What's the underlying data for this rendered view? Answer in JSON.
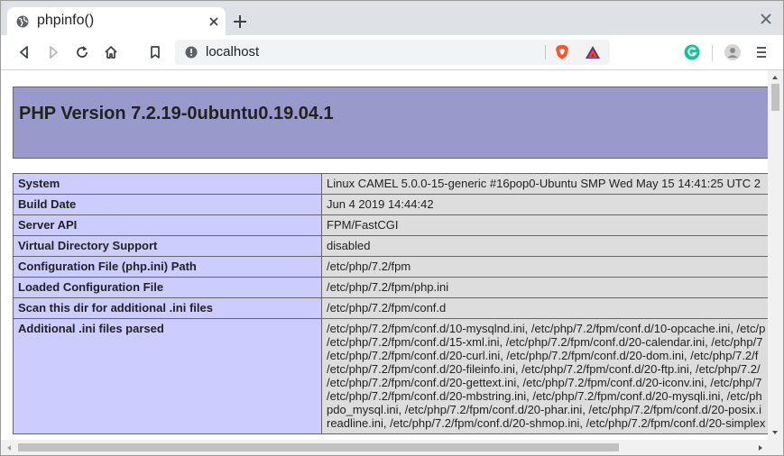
{
  "browser": {
    "tab": {
      "title": "phpinfo()",
      "favicon": "globe-icon"
    },
    "url": "localhost",
    "colors": {
      "tab_strip": "#dee1e6",
      "header_bg": "#9999cc",
      "label_bg": "#ccccff",
      "value_bg": "#dddddd"
    }
  },
  "page": {
    "title": "PHP Version 7.2.19-0ubuntu0.19.04.1",
    "rows": [
      {
        "label": "System",
        "value": "Linux CAMEL 5.0.0-15-generic #16pop0-Ubuntu SMP Wed May 15 14:41:25 UTC 2"
      },
      {
        "label": "Build Date",
        "value": "Jun 4 2019 14:44:42"
      },
      {
        "label": "Server API",
        "value": "FPM/FastCGI"
      },
      {
        "label": "Virtual Directory Support",
        "value": "disabled"
      },
      {
        "label": "Configuration File (php.ini) Path",
        "value": "/etc/php/7.2/fpm"
      },
      {
        "label": "Loaded Configuration File",
        "value": "/etc/php/7.2/fpm/php.ini"
      },
      {
        "label": "Scan this dir for additional .ini files",
        "value": "/etc/php/7.2/fpm/conf.d"
      }
    ],
    "ini_row": {
      "label": "Additional .ini files parsed",
      "lines": [
        "/etc/php/7.2/fpm/conf.d/10-mysqlnd.ini, /etc/php/7.2/fpm/conf.d/10-opcache.ini, /etc/p",
        "/etc/php/7.2/fpm/conf.d/15-xml.ini, /etc/php/7.2/fpm/conf.d/20-calendar.ini, /etc/php/7",
        "/etc/php/7.2/fpm/conf.d/20-curl.ini, /etc/php/7.2/fpm/conf.d/20-dom.ini, /etc/php/7.2/f",
        "/etc/php/7.2/fpm/conf.d/20-fileinfo.ini, /etc/php/7.2/fpm/conf.d/20-ftp.ini, /etc/php/7.2/",
        "/etc/php/7.2/fpm/conf.d/20-gettext.ini, /etc/php/7.2/fpm/conf.d/20-iconv.ini, /etc/php/7",
        "/etc/php/7.2/fpm/conf.d/20-mbstring.ini, /etc/php/7.2/fpm/conf.d/20-mysqli.ini, /etc/ph",
        "pdo_mysql.ini, /etc/php/7.2/fpm/conf.d/20-phar.ini, /etc/php/7.2/fpm/conf.d/20-posix.i",
        "readline.ini, /etc/php/7.2/fpm/conf.d/20-shmop.ini, /etc/php/7.2/fpm/conf.d/20-simplex"
      ]
    }
  }
}
